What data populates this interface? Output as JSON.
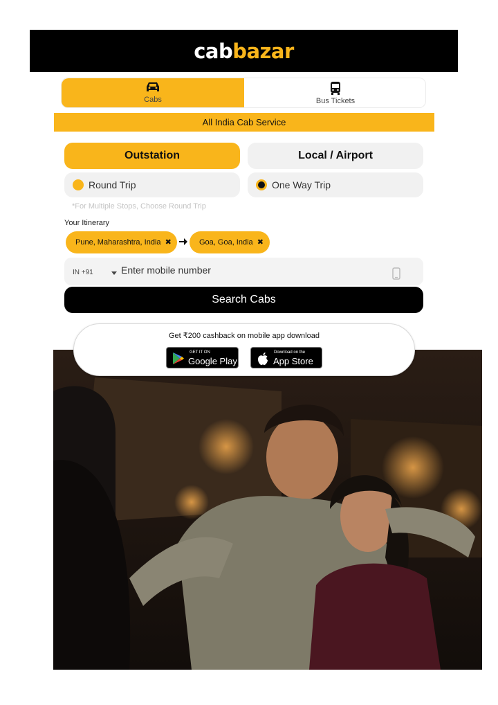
{
  "brand": {
    "logo_part1": "cab",
    "logo_part2": "bazar"
  },
  "tabs": [
    {
      "label": "Cabs",
      "icon": "car-icon",
      "active": true
    },
    {
      "label": "Bus Tickets",
      "icon": "bus-icon",
      "active": false
    }
  ],
  "banner": {
    "text": "All India Cab Service"
  },
  "trip_modes": {
    "outstation": "Outstation",
    "local": "Local / Airport"
  },
  "trip_types": {
    "round": "Round Trip",
    "oneway": "One Way Trip",
    "selected": "One Way Trip"
  },
  "note": "*For Multiple Stops, Choose Round Trip",
  "itinerary": {
    "label": "Your Itinerary",
    "from": "Pune, Maharashtra, India",
    "to": "Goa, Goa, India",
    "remove_glyph": "✖"
  },
  "mobile": {
    "country_code": "IN +91",
    "placeholder": "Enter mobile number"
  },
  "search_button": "Search Cabs",
  "promo": {
    "text": "Get ₹200 cashback on mobile app download",
    "google_small": "GET IT ON",
    "google_big": "Google Play",
    "apple_small": "Download on the",
    "apple_big": "App Store"
  },
  "colors": {
    "accent": "#f9b51b",
    "header": "#000000",
    "button": "#000000",
    "pill_bg": "#f1f1f1"
  }
}
